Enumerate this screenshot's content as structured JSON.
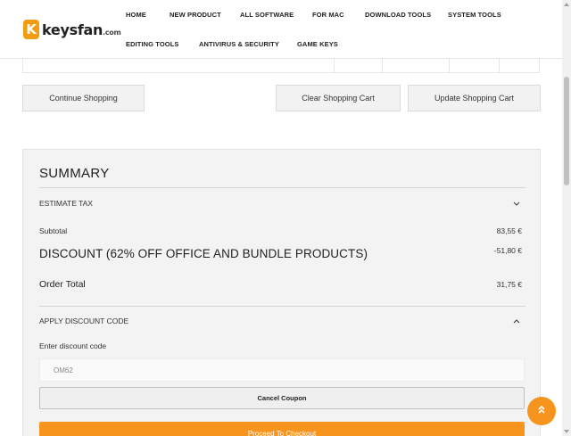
{
  "header": {
    "logo_letter": "K",
    "logo_name": "keysfan",
    "logo_suffix": ".com",
    "nav": [
      "HOME",
      "NEW PRODUCT",
      "ALL SOFTWARE",
      "FOR MAC",
      "DOWNLOAD TOOLS",
      "SYSTEM TOOLS",
      "EDITING TOOLS",
      "ANTIVIRUS & SECURITY",
      "GAME KEYS"
    ]
  },
  "cart_actions": {
    "continue": "Continue Shopping",
    "clear": "Clear Shopping Cart",
    "update": "Update Shopping Cart"
  },
  "summary": {
    "title": "SUMMARY",
    "estimate_tax": "ESTIMATE TAX",
    "subtotal_label": "Subtotal",
    "subtotal_value": "83,55 €",
    "discount_label": "DISCOUNT (62% OFF OFFICE AND BUNDLE PRODUCTS)",
    "discount_value": "-51,80 €",
    "order_total_label": "Order Total",
    "order_total_value": "31,75 €",
    "apply_discount": "APPLY DISCOUNT CODE",
    "enter_code_label": "Enter discount code",
    "code_value": "OM62",
    "cancel_coupon": "Cancel Coupon",
    "checkout": "Proceed To Checkout"
  },
  "icons": {
    "estimate_tax_toggle": "chevron-down-icon",
    "discount_toggle": "chevron-up-icon",
    "back_to_top": "double-chevron-up-icon"
  },
  "colors": {
    "accent": "#f7941d"
  }
}
